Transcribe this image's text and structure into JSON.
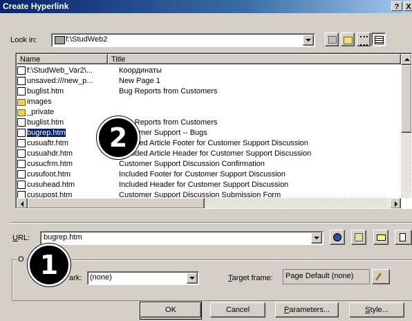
{
  "window": {
    "title": "Create Hyperlink",
    "help_glyph": "?",
    "close_glyph": "X"
  },
  "look_in": {
    "label": "Look in:",
    "value": "f:\\StudWeb2"
  },
  "list": {
    "columns": [
      "Name",
      "Title"
    ],
    "rows": [
      {
        "name": "f:\\StudWeb_Var2\\...",
        "title": "Координаты",
        "icon": "page-edit-icon"
      },
      {
        "name": "unsaved:///new_p...",
        "title": "New Page 1",
        "icon": "page-edit-icon"
      },
      {
        "name": "buglist.htm",
        "title": "Bug Reports from Customers",
        "icon": "page-edit-icon"
      },
      {
        "name": "images",
        "title": "",
        "icon": "folder-icon"
      },
      {
        "name": "_private",
        "title": "",
        "icon": "folder-icon"
      },
      {
        "name": "buglist.htm",
        "title": "Bug Reports from Customers",
        "icon": "page-icon"
      },
      {
        "name": "bugrep.htm",
        "title": "Customer Support -- Bugs",
        "icon": "page-icon",
        "selected": true
      },
      {
        "name": "cusuaftr.htm",
        "title": "Included Article Footer for Customer Support Discussion",
        "icon": "page-icon"
      },
      {
        "name": "cusuahdr.htm",
        "title": "Included Article Header for Customer Support Discussion",
        "icon": "page-icon"
      },
      {
        "name": "cusucfrm.htm",
        "title": "Customer Support Discussion Confirmation",
        "icon": "page-icon"
      },
      {
        "name": "cusufoot.htm",
        "title": "Included Footer for Customer Support Discussion",
        "icon": "page-icon"
      },
      {
        "name": "cusuhead.htm",
        "title": "Included Header for Customer Support Discussion",
        "icon": "page-icon"
      },
      {
        "name": "cusupost.htm",
        "title": "Customer Support Discussion Submission Form",
        "icon": "page-icon"
      }
    ]
  },
  "url": {
    "label": "URL:",
    "value": "bugrep.htm"
  },
  "optional": {
    "group_label": "O",
    "bookmark_label": "ark:",
    "bookmark_value": "(none)",
    "target_label": "Target frame:",
    "target_value": "Page Default (none)"
  },
  "buttons": {
    "ok": "OK",
    "cancel": "Cancel",
    "parameters": "Parameters...",
    "style": "Style..."
  },
  "annotations": {
    "one": "1",
    "two": "2"
  }
}
